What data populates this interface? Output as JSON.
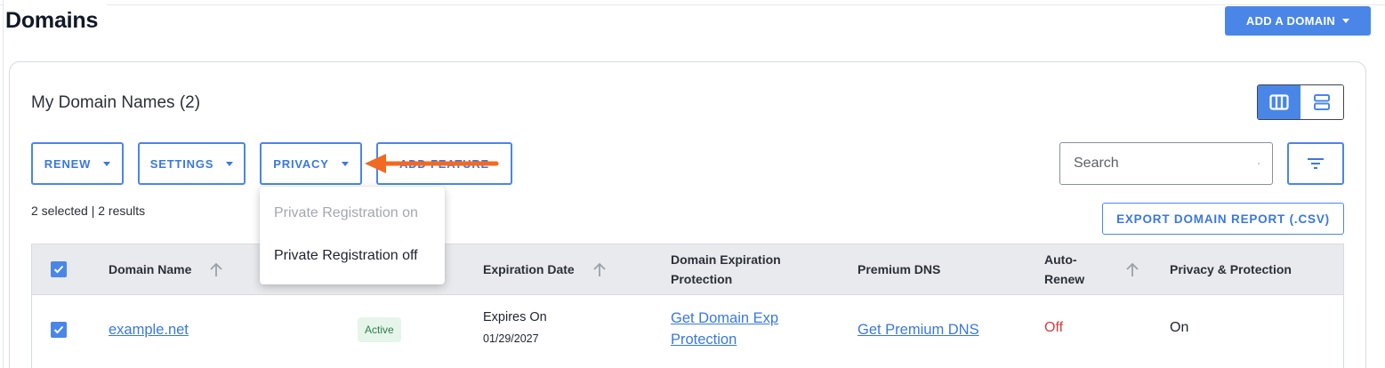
{
  "page": {
    "title": "Domains"
  },
  "header": {
    "add_domain_label": "ADD A DOMAIN"
  },
  "section": {
    "title": "My Domain Names (2)"
  },
  "toolbar": {
    "renew_label": "RENEW",
    "settings_label": "SETTINGS",
    "privacy_label": "PRIVACY",
    "add_feature_label": "ADD FEATURE",
    "search_placeholder": "Search",
    "export_label": "EXPORT DOMAIN REPORT (.CSV)"
  },
  "selection": {
    "info": "2 selected | 2 results"
  },
  "privacy_menu": {
    "items": [
      {
        "label": "Private Registration on",
        "enabled": false
      },
      {
        "label": "Private Registration off",
        "enabled": true
      }
    ]
  },
  "table": {
    "headers": {
      "domain_name": "Domain Name",
      "expiration_date": "Expiration Date",
      "domain_expiration_protection": "Domain Expiration Protection",
      "premium_dns": "Premium DNS",
      "auto_renew": "Auto-Renew",
      "privacy_protection": "Privacy & Protection"
    },
    "rows": [
      {
        "selected": true,
        "domain": "example.net",
        "status": "Active",
        "expires_label": "Expires On",
        "expires_date": "01/29/2027",
        "exp_protection_link": "Get Domain Exp Protection",
        "premium_dns_link": "Get Premium DNS",
        "auto_renew": "Off",
        "privacy": "On"
      }
    ]
  },
  "colors": {
    "accent": "#4a86e8",
    "link": "#3a78dd",
    "off": "#d33c44",
    "annotation_arrow": "#f06a22",
    "active_badge_bg": "#e6f5e9"
  },
  "icons": {
    "view_columns": "columns-view-icon",
    "view_rows": "rows-view-icon",
    "search": "search-icon",
    "filter": "filter-icon",
    "sort": "sort-up-arrow-icon"
  }
}
